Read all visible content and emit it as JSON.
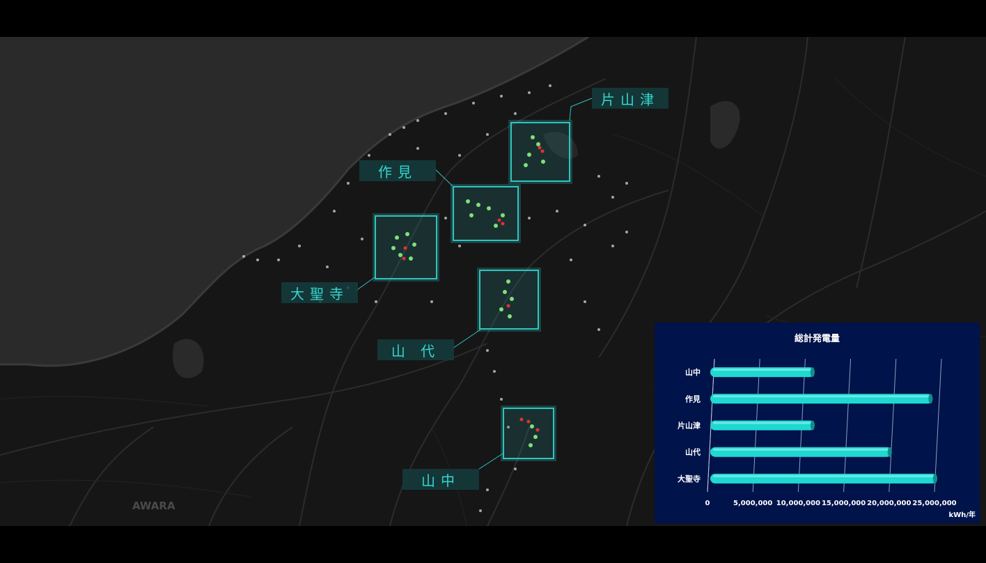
{
  "map": {
    "place_label": "AWARA",
    "areas": [
      {
        "id": "katayamazu",
        "label": "片山津"
      },
      {
        "id": "sakumi",
        "label": "作見"
      },
      {
        "id": "daishoji",
        "label": "大聖寺"
      },
      {
        "id": "yamashiro",
        "label": "山 代"
      },
      {
        "id": "yamanaka",
        "label": "山中"
      }
    ]
  },
  "panel": {
    "title": "総計発電量",
    "unit": "kWh/年"
  },
  "chart_data": {
    "type": "bar",
    "orientation": "horizontal",
    "title": "総計発電量",
    "xlabel": "kWh/年",
    "categories": [
      "山中",
      "作見",
      "片山津",
      "山代",
      "大聖寺"
    ],
    "values": [
      11800000,
      24800000,
      11800000,
      20300000,
      25300000
    ],
    "xlim": [
      0,
      25000000
    ],
    "xticks": [
      "0",
      "5,000,000",
      "10,000,000",
      "15,000,000",
      "20,000,000",
      "25,000,000"
    ],
    "grid": true,
    "colors": {
      "bar": "#1fd8d2",
      "background": "#00134a",
      "grid": "#8fa0c0"
    }
  }
}
